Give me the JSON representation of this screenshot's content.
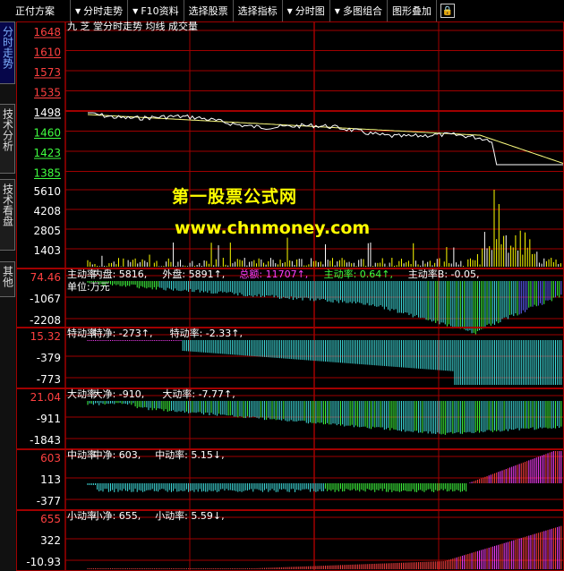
{
  "toolbar": {
    "items": [
      {
        "label": "正付方案",
        "arrow": false
      },
      {
        "label": "分时走势",
        "arrow": true
      },
      {
        "label": "F10资料",
        "arrow": true
      },
      {
        "label": "选择股票",
        "arrow": false
      },
      {
        "label": "选择指标",
        "arrow": false
      },
      {
        "label": "分时图",
        "arrow": true
      },
      {
        "label": "多图组合",
        "arrow": true
      },
      {
        "label": "图形叠加",
        "arrow": false
      }
    ],
    "lock_icon": "lock-icon"
  },
  "side_tabs": [
    {
      "label": "分时走势",
      "active": true
    },
    {
      "label": "技术分析",
      "active": false
    },
    {
      "label": "技术看盘",
      "active": false
    },
    {
      "label": "其他",
      "active": false
    }
  ],
  "colors": {
    "up": "#ff4040",
    "down": "#40ff40",
    "cyan": "#40e0e0",
    "yellow": "#ffff00",
    "magenta": "#ff40ff",
    "grid": "#a00000",
    "price_line": "#ffffff",
    "avg_line": "#ffff80"
  },
  "watermark": {
    "line1": "第一股票公式网",
    "line2": "www.chnmoney.com"
  },
  "main_panel": {
    "title": "九 芝 堂分时走势  均线  成交量",
    "price_axis": [
      {
        "label": "1648",
        "color": "up"
      },
      {
        "label": "1610",
        "color": "up"
      },
      {
        "label": "1573",
        "color": "up"
      },
      {
        "label": "1535",
        "color": "up"
      },
      {
        "label": "1498",
        "color": "white"
      },
      {
        "label": "1460",
        "color": "down"
      },
      {
        "label": "1423",
        "color": "down"
      },
      {
        "label": "1385",
        "color": "down"
      }
    ],
    "volume_axis": [
      "5610",
      "4208",
      "2805",
      "1403"
    ]
  },
  "indicators": [
    {
      "id": "zhudong",
      "axis": [
        "74.46",
        "-1067",
        "-2208"
      ],
      "legend": [
        {
          "text": "主动率",
          "color": "#ffffff"
        },
        {
          "text": "内盘: 5816,",
          "color": "#ffffff"
        },
        {
          "text": "外盘: 5891↑,",
          "color": "#ffffff"
        },
        {
          "text": "总额: 11707↑,",
          "color": "#ff40ff"
        },
        {
          "text": "主动率: 0.64↑,",
          "color": "#40ff40"
        },
        {
          "text": "主动率B: -0.05,",
          "color": "#ffffff"
        },
        {
          "text": "单位:万元",
          "color": "#ffffff"
        }
      ]
    },
    {
      "id": "tedong",
      "axis": [
        "15.32",
        "-379",
        "-773"
      ],
      "legend": [
        {
          "text": "特动率",
          "color": "#ffffff"
        },
        {
          "text": "特净: -273↑,",
          "color": "#ffffff"
        },
        {
          "text": "特动率: -2.33↑,",
          "color": "#ffffff"
        }
      ]
    },
    {
      "id": "dadong",
      "axis": [
        "21.04",
        "-911",
        "-1843"
      ],
      "legend": [
        {
          "text": "大动率",
          "color": "#ffffff"
        },
        {
          "text": "大净: -910,",
          "color": "#ffffff"
        },
        {
          "text": "大动率: -7.77↑,",
          "color": "#ffffff"
        }
      ]
    },
    {
      "id": "zhongdong",
      "axis": [
        "603",
        "113",
        "-377"
      ],
      "legend": [
        {
          "text": "中动率",
          "color": "#ffffff"
        },
        {
          "text": "中净: 603,",
          "color": "#ffffff"
        },
        {
          "text": "中动率: 5.15↓,",
          "color": "#ffffff"
        }
      ]
    },
    {
      "id": "xiaodong",
      "axis": [
        "655",
        "322",
        "-10.93"
      ],
      "legend": [
        {
          "text": "小动率",
          "color": "#ffffff"
        },
        {
          "text": "小净: 655,",
          "color": "#ffffff"
        },
        {
          "text": "小动率: 5.59↓,",
          "color": "#ffffff"
        }
      ]
    }
  ]
}
